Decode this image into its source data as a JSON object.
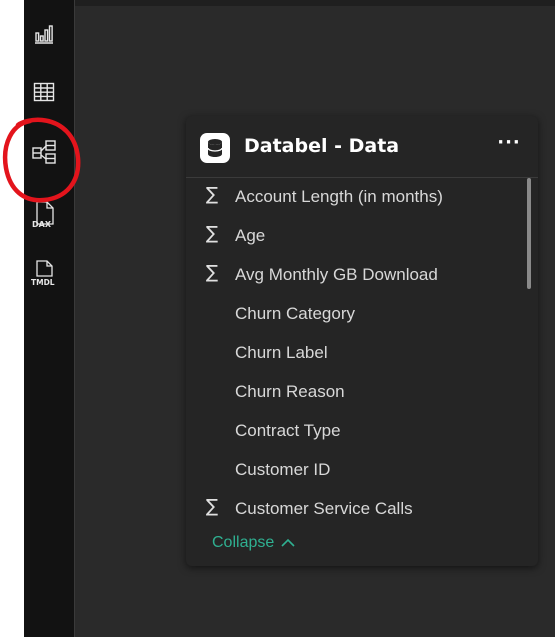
{
  "rail": {
    "items": [
      {
        "name": "report-view",
        "icon": "bar-chart-icon",
        "label": ""
      },
      {
        "name": "table-view",
        "icon": "table-grid-icon",
        "label": ""
      },
      {
        "name": "model-view",
        "icon": "model-diagram-icon",
        "label": "",
        "selected": true
      },
      {
        "name": "dax-query-view",
        "icon": "dax-icon",
        "label": "DAX"
      },
      {
        "name": "tmdl-view",
        "icon": "tmdl-icon",
        "label": "TMDL"
      }
    ]
  },
  "card": {
    "title": "Databel - Data",
    "more_label": "···",
    "fields": [
      {
        "label": "Account Length (in months)",
        "sigma": "∑"
      },
      {
        "label": "Age",
        "sigma": "∑"
      },
      {
        "label": "Avg Monthly GB Download",
        "sigma": "∑"
      },
      {
        "label": "Churn Category",
        "sigma": ""
      },
      {
        "label": "Churn Label",
        "sigma": ""
      },
      {
        "label": "Churn Reason",
        "sigma": ""
      },
      {
        "label": "Contract Type",
        "sigma": ""
      },
      {
        "label": "Customer ID",
        "sigma": ""
      },
      {
        "label": "Customer Service Calls",
        "sigma": "∑"
      }
    ],
    "collapse_label": "Collapse"
  },
  "colors": {
    "canvas": "#2a2a2a",
    "rail": "#121212",
    "card": "#252525",
    "accent_link": "#2fb091",
    "annotation": "#e3141c"
  }
}
